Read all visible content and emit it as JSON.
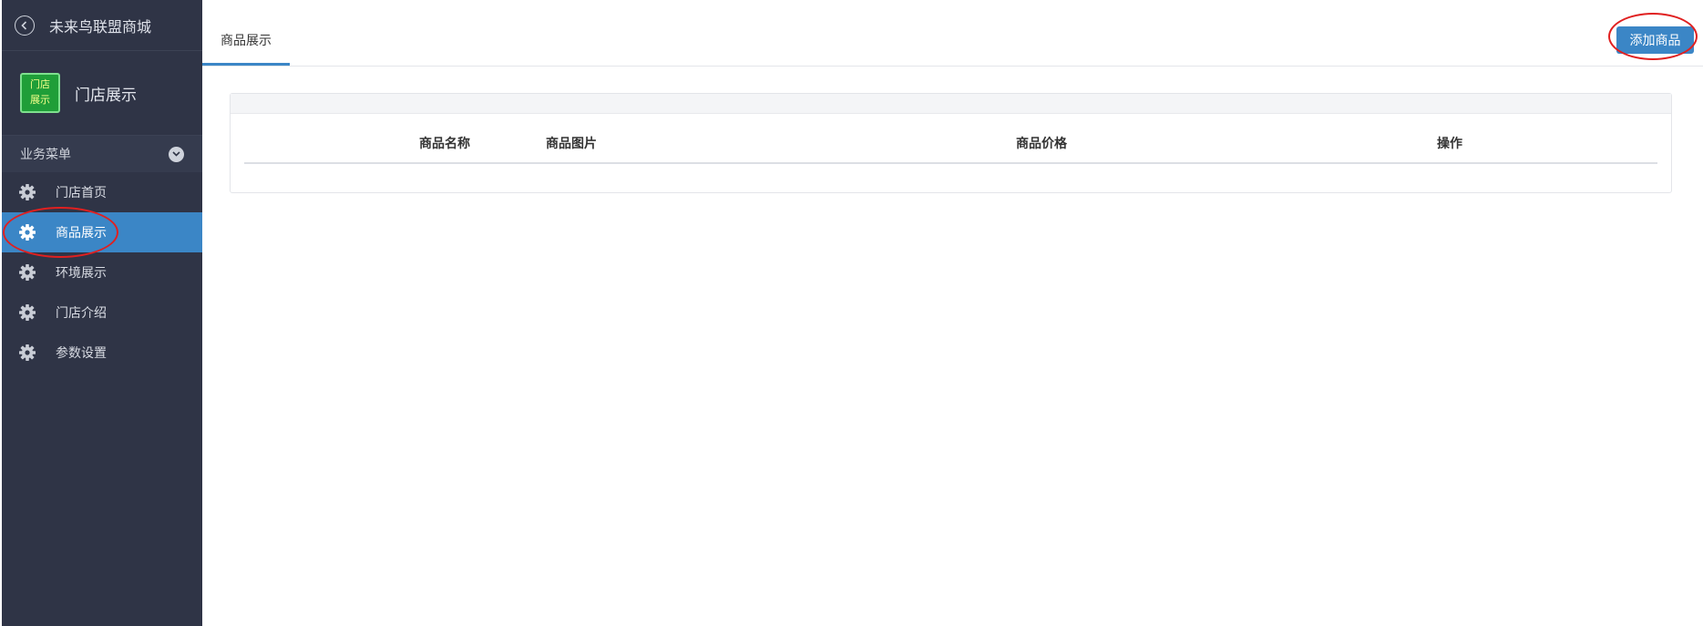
{
  "sidebar": {
    "title": "未来鸟联盟商城",
    "store_name": "门店展示",
    "store_logo_text": [
      "门店",
      "展示"
    ],
    "menu_header": "业务菜单",
    "items": [
      {
        "label": "门店首页",
        "active": false
      },
      {
        "label": "商品展示",
        "active": true
      },
      {
        "label": "环境展示",
        "active": false
      },
      {
        "label": "门店介绍",
        "active": false
      },
      {
        "label": "参数设置",
        "active": false
      }
    ]
  },
  "main": {
    "tab_label": "商品展示",
    "add_button_label": "添加商品",
    "table": {
      "columns": [
        "商品名称",
        "商品图片",
        "商品价格",
        "操作"
      ],
      "rows": []
    }
  },
  "colors": {
    "sidebar_bg": "#2f3446",
    "accent": "#3b86c6",
    "annotation": "#e02020"
  }
}
